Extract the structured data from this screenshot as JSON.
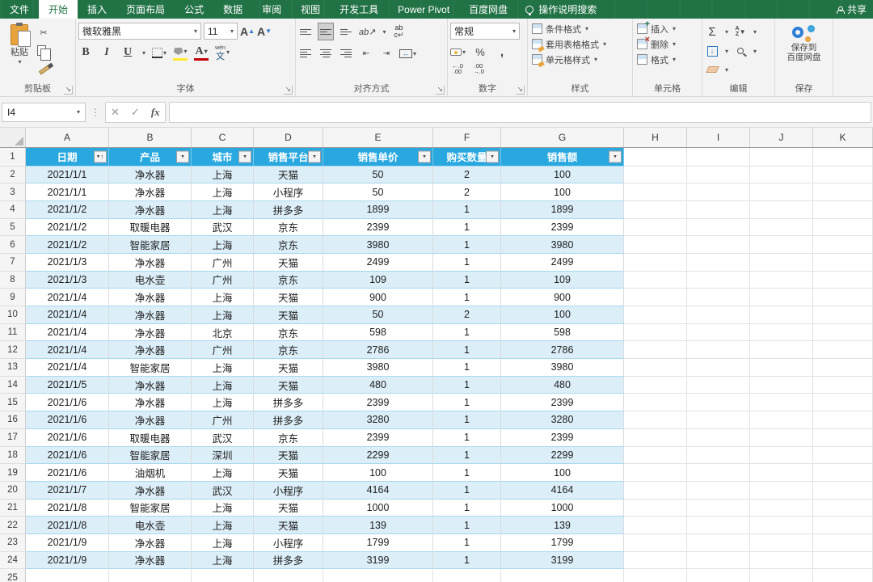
{
  "titlebar": {
    "tabs": [
      "文件",
      "开始",
      "插入",
      "页面布局",
      "公式",
      "数据",
      "审阅",
      "视图",
      "开发工具",
      "Power Pivot",
      "百度网盘"
    ],
    "active_tab": "开始",
    "search_label": "操作说明搜索",
    "share_label": "共享"
  },
  "ribbon": {
    "clipboard": {
      "label": "剪贴板",
      "paste_label": "粘贴"
    },
    "font": {
      "label": "字体",
      "font_name": "微软雅黑",
      "font_size": "11",
      "bold": "B",
      "italic": "I",
      "underline": "U",
      "wen_top": "wén",
      "wen_char": "文"
    },
    "alignment": {
      "label": "对齐方式",
      "wrap_top": "ab",
      "wrap_bottom": "c↵",
      "orient": "ab↗"
    },
    "number": {
      "label": "数字",
      "format_value": "常规",
      "percent": "%",
      "comma": ",",
      "dec_inc": "←.0\n.00",
      "dec_dec": ".00\n→.0"
    },
    "styles": {
      "label": "样式",
      "items": [
        "条件格式",
        "套用表格格式",
        "单元格样式"
      ]
    },
    "cells": {
      "label": "单元格",
      "items": [
        "插入",
        "删除",
        "格式"
      ]
    },
    "editing": {
      "label": "编辑",
      "sigma": "Σ",
      "sort_top": "A",
      "sort_bottom": "Z"
    },
    "save": {
      "label": "保存",
      "button_line1": "保存到",
      "button_line2": "百度网盘"
    }
  },
  "formula_bar": {
    "name_box": "I4",
    "formula": "",
    "fx": "fx",
    "cancel": "✕",
    "enter": "✓"
  },
  "grid": {
    "column_letters": [
      "A",
      "B",
      "C",
      "D",
      "E",
      "F",
      "G",
      "H",
      "I",
      "J",
      "K"
    ],
    "table": {
      "headers": [
        "日期",
        "产品",
        "城市",
        "销售平台",
        "销售单价",
        "购买数量",
        "销售额"
      ],
      "sorted_column": "日期",
      "rows": [
        [
          "2021/1/1",
          "净水器",
          "上海",
          "天猫",
          "50",
          "2",
          "100"
        ],
        [
          "2021/1/1",
          "净水器",
          "上海",
          "小程序",
          "50",
          "2",
          "100"
        ],
        [
          "2021/1/2",
          "净水器",
          "上海",
          "拼多多",
          "1899",
          "1",
          "1899"
        ],
        [
          "2021/1/2",
          "取暖电器",
          "武汉",
          "京东",
          "2399",
          "1",
          "2399"
        ],
        [
          "2021/1/2",
          "智能家居",
          "上海",
          "京东",
          "3980",
          "1",
          "3980"
        ],
        [
          "2021/1/3",
          "净水器",
          "广州",
          "天猫",
          "2499",
          "1",
          "2499"
        ],
        [
          "2021/1/3",
          "电水壶",
          "广州",
          "京东",
          "109",
          "1",
          "109"
        ],
        [
          "2021/1/4",
          "净水器",
          "上海",
          "天猫",
          "900",
          "1",
          "900"
        ],
        [
          "2021/1/4",
          "净水器",
          "上海",
          "天猫",
          "50",
          "2",
          "100"
        ],
        [
          "2021/1/4",
          "净水器",
          "北京",
          "京东",
          "598",
          "1",
          "598"
        ],
        [
          "2021/1/4",
          "净水器",
          "广州",
          "京东",
          "2786",
          "1",
          "2786"
        ],
        [
          "2021/1/4",
          "智能家居",
          "上海",
          "天猫",
          "3980",
          "1",
          "3980"
        ],
        [
          "2021/1/5",
          "净水器",
          "上海",
          "天猫",
          "480",
          "1",
          "480"
        ],
        [
          "2021/1/6",
          "净水器",
          "上海",
          "拼多多",
          "2399",
          "1",
          "2399"
        ],
        [
          "2021/1/6",
          "净水器",
          "广州",
          "拼多多",
          "3280",
          "1",
          "3280"
        ],
        [
          "2021/1/6",
          "取暖电器",
          "武汉",
          "京东",
          "2399",
          "1",
          "2399"
        ],
        [
          "2021/1/6",
          "智能家居",
          "深圳",
          "天猫",
          "2299",
          "1",
          "2299"
        ],
        [
          "2021/1/6",
          "油烟机",
          "上海",
          "天猫",
          "100",
          "1",
          "100"
        ],
        [
          "2021/1/7",
          "净水器",
          "武汉",
          "小程序",
          "4164",
          "1",
          "4164"
        ],
        [
          "2021/1/8",
          "智能家居",
          "上海",
          "天猫",
          "1000",
          "1",
          "1000"
        ],
        [
          "2021/1/8",
          "电水壶",
          "上海",
          "天猫",
          "139",
          "1",
          "139"
        ],
        [
          "2021/1/9",
          "净水器",
          "上海",
          "小程序",
          "1799",
          "1",
          "1799"
        ],
        [
          "2021/1/9",
          "净水器",
          "上海",
          "拼多多",
          "3199",
          "1",
          "3199"
        ]
      ],
      "first_data_row_number": 2
    }
  },
  "colors": {
    "green": "#217346",
    "header_blue": "#29a8e0",
    "band_blue": "#dceef8",
    "band_border": "#a9d8ef",
    "fontcolor_red": "#c00000"
  }
}
